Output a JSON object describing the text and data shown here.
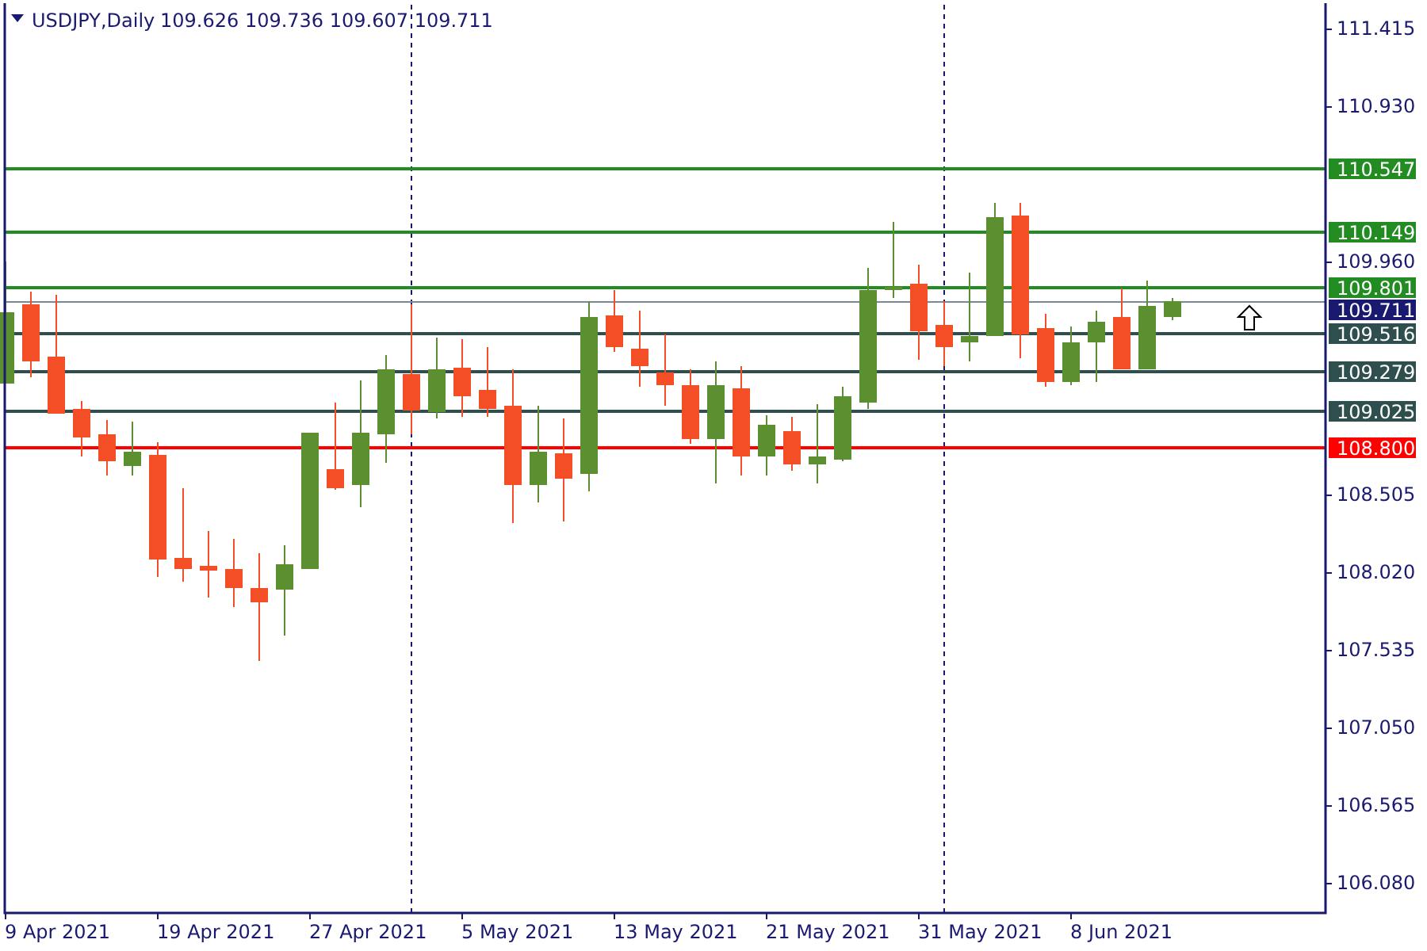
{
  "header": {
    "symbol": "USDJPY,Daily",
    "quote": "109.626 109.736 109.607 109.711"
  },
  "price_axis": {
    "ticks": [
      "111.415",
      "110.930",
      "109.960",
      "108.505",
      "108.020",
      "107.535",
      "107.050",
      "106.565",
      "106.080"
    ]
  },
  "date_axis": {
    "ticks": [
      "9 Apr 2021",
      "19 Apr 2021",
      "27 Apr 2021",
      "5 May 2021",
      "13 May 2021",
      "21 May 2021",
      "31 May 2021",
      "8 Jun 2021"
    ]
  },
  "levels": [
    {
      "label": "110.547",
      "kind": "line",
      "color": "#228b22"
    },
    {
      "label": "110.149",
      "kind": "line",
      "color": "#228b22"
    },
    {
      "label": "109.801",
      "kind": "line",
      "color": "#228b22"
    },
    {
      "label": "109.711",
      "kind": "current",
      "color": "#191970"
    },
    {
      "label": "109.516",
      "kind": "line",
      "color": "#2f4f4f"
    },
    {
      "label": "109.279",
      "kind": "line",
      "color": "#2f4f4f"
    },
    {
      "label": "109.025",
      "kind": "line",
      "color": "#2f4f4f"
    },
    {
      "label": "108.800",
      "kind": "line",
      "color": "#ff0000"
    }
  ]
}
